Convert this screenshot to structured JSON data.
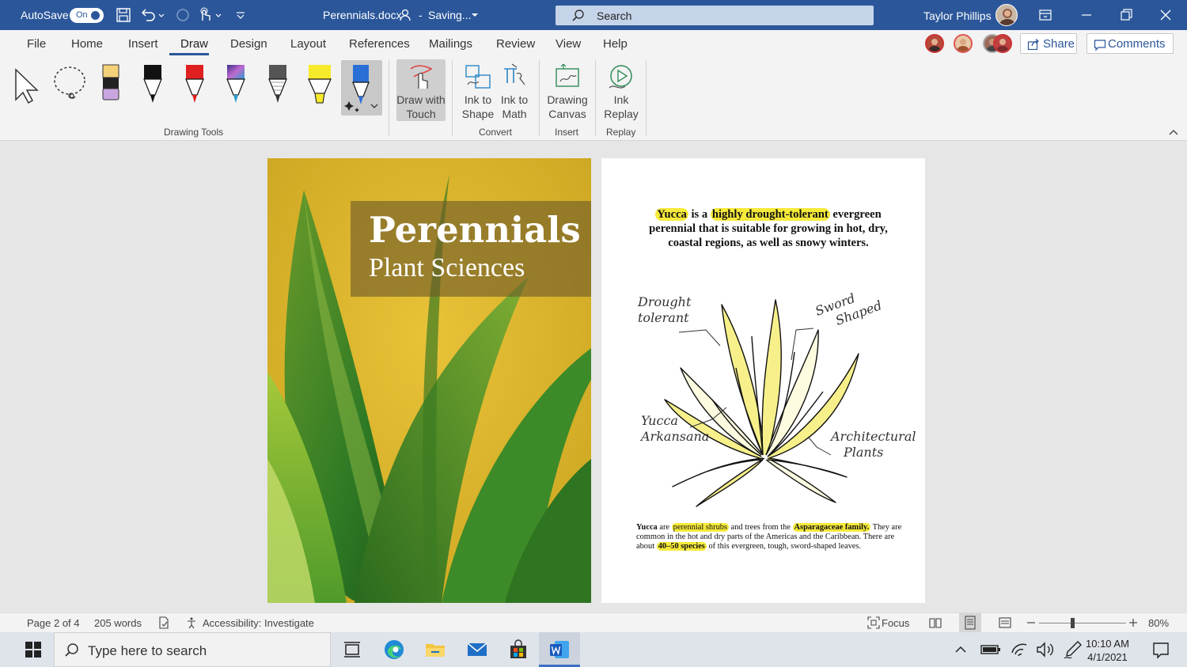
{
  "titlebar": {
    "autosave_label": "AutoSave",
    "autosave_state": "On",
    "document_title": "Perennials.docx",
    "save_status": "Saving...",
    "search_placeholder": "Search",
    "user_name": "Taylor Phillips"
  },
  "tabs": [
    "File",
    "Home",
    "Insert",
    "Draw",
    "Design",
    "Layout",
    "References",
    "Mailings",
    "Review",
    "View",
    "Help"
  ],
  "active_tab": "Draw",
  "collaboration": {
    "share_label": "Share",
    "comments_label": "Comments"
  },
  "ribbon": {
    "drawing_tools_label": "Drawing Tools",
    "draw_with_touch": "Draw with Touch",
    "ink_to_shape": "Ink to Shape",
    "ink_to_math": "Ink to Math",
    "convert_label": "Convert",
    "drawing_canvas": "Drawing Canvas",
    "insert_label": "Insert",
    "ink_replay": "Ink Replay",
    "replay_label": "Replay",
    "pens": [
      {
        "name": "pencil-light",
        "color": "#f3d27a",
        "tip": "#c9a6e0"
      },
      {
        "name": "pen-black",
        "color": "#111111"
      },
      {
        "name": "pen-red",
        "color": "#e02020"
      },
      {
        "name": "pen-galaxy",
        "color": "#3a3a8a"
      },
      {
        "name": "pencil-gray",
        "color": "#555555"
      },
      {
        "name": "highlighter-yellow",
        "color": "#f6ea2a"
      },
      {
        "name": "pen-blue-glitter",
        "color": "#2a6fd6"
      }
    ]
  },
  "cover_page": {
    "title": "Perennials",
    "subtitle": "Plant Sciences"
  },
  "content_page": {
    "intro_parts": [
      "Yucca",
      " is a ",
      "highly drought-tolerant",
      " evergreen perennial that is suitable for growing in hot, dry, coastal regions, as well as snowy winters."
    ],
    "annotations": {
      "drought_1": "Drought",
      "drought_2": "tolerant",
      "sword_1": "Sword",
      "sword_2": "Shaped",
      "yucca_1": "Yucca",
      "yucca_2": "Arkansana",
      "arch_1": "Architectural",
      "arch_2": "Plants"
    },
    "body_parts": [
      "Yucca",
      " are ",
      "perennial shrubs",
      " and trees from the ",
      "Asparagaceae family.",
      " They are common in the hot and dry parts of the Americas and the Caribbean. There are about ",
      "40–50 species",
      " of this evergreen, tough, sword-shaped leaves."
    ]
  },
  "statusbar": {
    "page": "Page 2 of 4",
    "words": "205 words",
    "accessibility": "Accessibility: Investigate",
    "focus": "Focus",
    "zoom": "80%"
  },
  "taskbar": {
    "search_placeholder": "Type here to search",
    "time": "10:10 AM",
    "date": "4/1/2021"
  },
  "colors": {
    "word_blue": "#2b579a",
    "highlight": "#f6ea3a"
  }
}
